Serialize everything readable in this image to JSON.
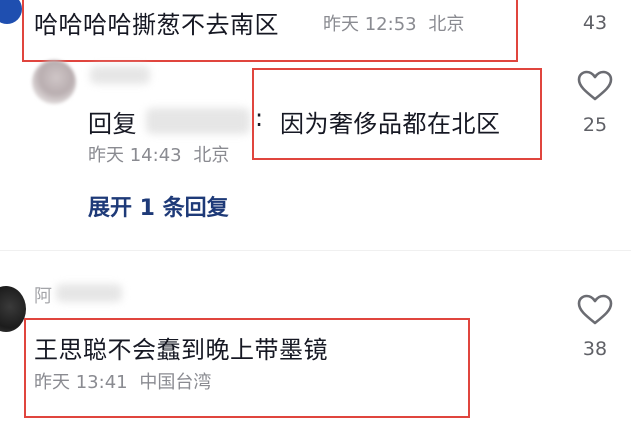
{
  "comment1": {
    "text": "哈哈哈哈撕葱不去南区",
    "time": "昨天 12:53",
    "location": "北京",
    "likes": "43"
  },
  "reply": {
    "prefix": "回复",
    "separator": ":",
    "text": "因为奢侈品都在北区",
    "time": "昨天 14:43",
    "location": "北京",
    "likes": "25",
    "expand": "展开 1 条回复"
  },
  "comment2": {
    "username_partial": "阿",
    "text": "王思聪不会蠢到晚上带墨镜",
    "time": "昨天 13:41",
    "location": "中国台湾",
    "likes": "38"
  }
}
